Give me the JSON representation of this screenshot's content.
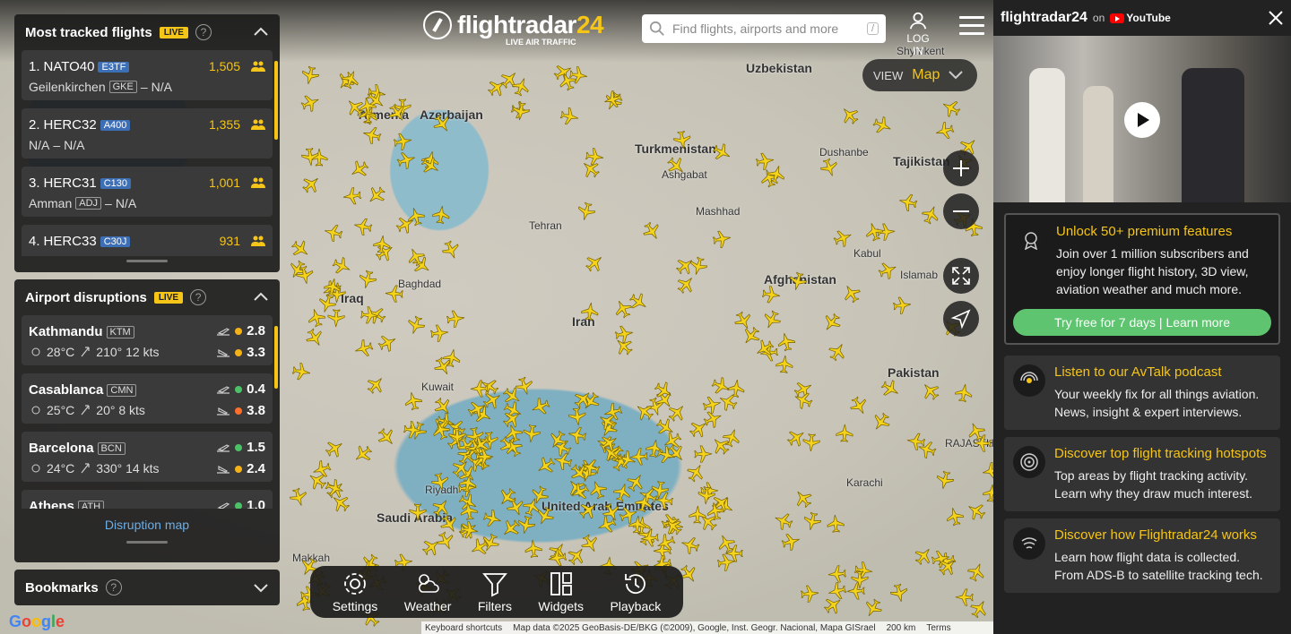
{
  "header": {
    "logo_text": "flightradar",
    "logo_num": "24",
    "logo_sub": "LIVE AIR TRAFFIC",
    "search_placeholder": "Find flights, airports and more",
    "search_shortcut": "/",
    "login_label": "LOG IN",
    "view_label": "VIEW",
    "view_value": "Map"
  },
  "most_tracked": {
    "title": "Most tracked flights",
    "live": "LIVE",
    "items": [
      {
        "rank": "1.",
        "callsign": "NATO40",
        "type": "E3TF",
        "count": "1,505",
        "from": "Geilenkirchen",
        "from_code": "GKE",
        "to": "N/A"
      },
      {
        "rank": "2.",
        "callsign": "HERC32",
        "type": "A400",
        "count": "1,355",
        "from": "N/A",
        "from_code": "",
        "to": "N/A"
      },
      {
        "rank": "3.",
        "callsign": "HERC31",
        "type": "C130",
        "count": "1,001",
        "from": "Amman",
        "from_code": "ADJ",
        "to": "N/A"
      },
      {
        "rank": "4.",
        "callsign": "HERC33",
        "type": "C30J",
        "count": "931",
        "from": "",
        "from_code": "",
        "to": ""
      }
    ]
  },
  "disruptions": {
    "title": "Airport disruptions",
    "live": "LIVE",
    "link": "Disruption map",
    "items": [
      {
        "name": "Kathmandu",
        "code": "KTM",
        "temp": "28°C",
        "wind": "210° 12 kts",
        "dep": "2.8",
        "arr": "3.3",
        "dep_color": "#f5b218",
        "arr_color": "#f5b218"
      },
      {
        "name": "Casablanca",
        "code": "CMN",
        "temp": "25°C",
        "wind": "20° 8 kts",
        "dep": "0.4",
        "arr": "3.8",
        "dep_color": "#4cc266",
        "arr_color": "#ff6f2c"
      },
      {
        "name": "Barcelona",
        "code": "BCN",
        "temp": "24°C",
        "wind": "330° 14 kts",
        "dep": "1.5",
        "arr": "2.4",
        "dep_color": "#4cc266",
        "arr_color": "#f5b218"
      },
      {
        "name": "Athens",
        "code": "ATH",
        "temp": "",
        "wind": "",
        "dep": "1.0",
        "arr": "",
        "dep_color": "#4cc266",
        "arr_color": ""
      }
    ]
  },
  "bookmarks": {
    "title": "Bookmarks"
  },
  "toolbar": [
    {
      "label": "Settings",
      "icon": "gear-icon"
    },
    {
      "label": "Weather",
      "icon": "weather-icon"
    },
    {
      "label": "Filters",
      "icon": "filter-icon"
    },
    {
      "label": "Widgets",
      "icon": "widgets-icon"
    },
    {
      "label": "Playback",
      "icon": "playback-icon"
    }
  ],
  "map": {
    "labels": [
      {
        "text": "Uzbekistan",
        "kind": "country"
      },
      {
        "text": "Turkmenistan",
        "kind": "country"
      },
      {
        "text": "Ashgabat",
        "kind": "city"
      },
      {
        "text": "Dushanbe",
        "kind": "city"
      },
      {
        "text": "Tajikistan",
        "kind": "country"
      },
      {
        "text": "Armenia",
        "kind": "country"
      },
      {
        "text": "Azerbaijan",
        "kind": "country"
      },
      {
        "text": "Tehran",
        "kind": "city"
      },
      {
        "text": "Mashhad",
        "kind": "city"
      },
      {
        "text": "Kabul",
        "kind": "city"
      },
      {
        "text": "Afghanistan",
        "kind": "country"
      },
      {
        "text": "Islamab",
        "kind": "city"
      },
      {
        "text": "Iraq",
        "kind": "country"
      },
      {
        "text": "Baghdad",
        "kind": "city"
      },
      {
        "text": "Iran",
        "kind": "country"
      },
      {
        "text": "Pakistan",
        "kind": "country"
      },
      {
        "text": "Kuwait",
        "kind": "city"
      },
      {
        "text": "Karachi",
        "kind": "city"
      },
      {
        "text": "Riyadh",
        "kind": "city"
      },
      {
        "text": "United Arab Emirates",
        "kind": "country"
      },
      {
        "text": "Saudi Arabia",
        "kind": "country"
      },
      {
        "text": "Makkah",
        "kind": "city"
      },
      {
        "text": "RAJASTH",
        "kind": "city"
      },
      {
        "text": "Shymkent",
        "kind": "city"
      }
    ],
    "attribution": "Map data ©2025 GeoBasis-DE/BKG (©2009), Google, Inst. Geogr. Nacional, Mapa GISrael",
    "keyboard": "Keyboard shortcuts",
    "scale": "200 km",
    "terms": "Terms",
    "google": [
      "G",
      "o",
      "o",
      "g",
      "l",
      "e"
    ]
  },
  "sidebar": {
    "brand": "flightradar24",
    "on": "on",
    "youtube": "YouTube",
    "promos": [
      {
        "title": "Unlock 50+ premium features",
        "text": "Join over 1 million subscribers and enjoy longer flight history, 3D view, aviation weather and much more.",
        "button": "Try free for 7 days | Learn more",
        "icon": "badge-icon"
      },
      {
        "title": "Listen to our AvTalk podcast",
        "text": "Your weekly fix for all things aviation. News, insight & expert interviews.",
        "icon": "podcast-icon"
      },
      {
        "title": "Discover top flight tracking hotspots",
        "text": "Top areas by flight tracking activity. Learn why they draw much interest.",
        "icon": "hotspot-icon"
      },
      {
        "title": "Discover how Flightradar24 works",
        "text": "Learn how flight data is collected. From ADS-B to satellite tracking tech.",
        "icon": "signal-icon"
      }
    ]
  },
  "colors": {
    "accent": "#f5c518",
    "panel": "#1c1c1c",
    "link": "#6aaee8",
    "cta": "#5ec46f"
  }
}
